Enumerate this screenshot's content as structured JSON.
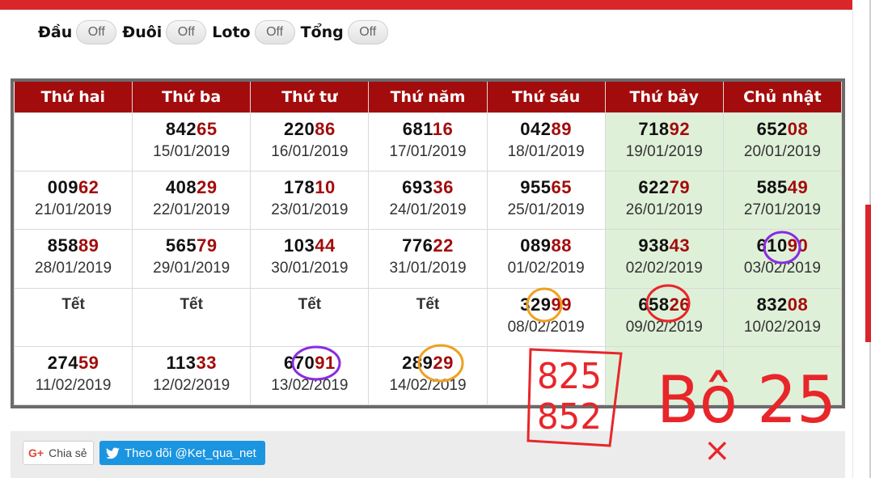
{
  "filters": [
    {
      "label": "Đầu",
      "state": "Off"
    },
    {
      "label": "Đuôi",
      "state": "Off"
    },
    {
      "label": "Loto",
      "state": "Off"
    },
    {
      "label": "Tổng",
      "state": "Off"
    }
  ],
  "calendar": {
    "headers": [
      "Thứ hai",
      "Thứ ba",
      "Thứ tư",
      "Thứ năm",
      "Thứ sáu",
      "Thứ bảy",
      "Chủ nhật"
    ],
    "rows": [
      [
        {
          "head": "",
          "tail": "",
          "date": ""
        },
        {
          "head": "842",
          "tail": "65",
          "date": "15/01/2019"
        },
        {
          "head": "220",
          "tail": "86",
          "date": "16/01/2019"
        },
        {
          "head": "681",
          "tail": "16",
          "date": "17/01/2019"
        },
        {
          "head": "042",
          "tail": "89",
          "date": "18/01/2019"
        },
        {
          "head": "718",
          "tail": "92",
          "date": "19/01/2019"
        },
        {
          "head": "652",
          "tail": "08",
          "date": "20/01/2019"
        }
      ],
      [
        {
          "head": "009",
          "tail": "62",
          "date": "21/01/2019"
        },
        {
          "head": "408",
          "tail": "29",
          "date": "22/01/2019"
        },
        {
          "head": "178",
          "tail": "10",
          "date": "23/01/2019"
        },
        {
          "head": "693",
          "tail": "36",
          "date": "24/01/2019"
        },
        {
          "head": "955",
          "tail": "65",
          "date": "25/01/2019"
        },
        {
          "head": "622",
          "tail": "79",
          "date": "26/01/2019"
        },
        {
          "head": "585",
          "tail": "49",
          "date": "27/01/2019"
        }
      ],
      [
        {
          "head": "858",
          "tail": "89",
          "date": "28/01/2019"
        },
        {
          "head": "565",
          "tail": "79",
          "date": "29/01/2019"
        },
        {
          "head": "103",
          "tail": "44",
          "date": "30/01/2019"
        },
        {
          "head": "776",
          "tail": "22",
          "date": "31/01/2019"
        },
        {
          "head": "089",
          "tail": "88",
          "date": "01/02/2019"
        },
        {
          "head": "938",
          "tail": "43",
          "date": "02/02/2019"
        },
        {
          "head": "610",
          "tail": "90",
          "date": "03/02/2019"
        }
      ],
      [
        {
          "tet": "Tết"
        },
        {
          "tet": "Tết"
        },
        {
          "tet": "Tết"
        },
        {
          "tet": "Tết"
        },
        {
          "head": "329",
          "tail": "99",
          "date": "08/02/2019"
        },
        {
          "head": "658",
          "tail": "26",
          "date": "09/02/2019"
        },
        {
          "head": "832",
          "tail": "08",
          "date": "10/02/2019"
        }
      ],
      [
        {
          "head": "274",
          "tail": "59",
          "date": "11/02/2019"
        },
        {
          "head": "113",
          "tail": "33",
          "date": "12/02/2019"
        },
        {
          "head": "670",
          "tail": "91",
          "date": "13/02/2019"
        },
        {
          "head": "289",
          "tail": "29",
          "date": "14/02/2019"
        },
        {
          "head": "",
          "tail": "",
          "date": ""
        },
        {
          "head": "",
          "tail": "",
          "date": ""
        },
        {
          "head": "",
          "tail": "",
          "date": ""
        }
      ]
    ]
  },
  "handwriting": {
    "box_line1": "825",
    "box_line2": "852",
    "note": "Bô 25",
    "mark": "×"
  },
  "share": {
    "gplus_label": "Chia sẻ",
    "twitter_label": "Theo dõi @Ket_qua_net"
  },
  "colors": {
    "header_red": "#a30c0c",
    "top_red": "#d8262a",
    "weekend_green": "#dff0d8",
    "ink_red": "#e8262a",
    "ink_orange": "#f0a020",
    "ink_purple": "#8a2be2",
    "twitter_blue": "#1b95e0"
  }
}
